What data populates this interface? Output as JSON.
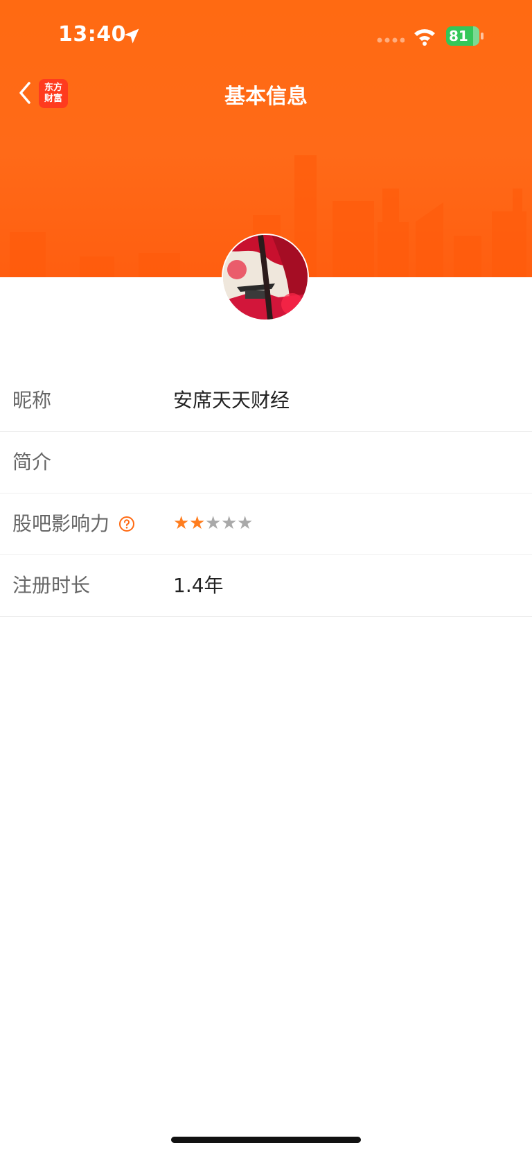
{
  "status_bar": {
    "time": "13:40",
    "battery": "81"
  },
  "nav": {
    "title": "基本信息",
    "logo_line1": "东方",
    "logo_line2": "财富"
  },
  "profile": {
    "rows": [
      {
        "label": "昵称",
        "value": "安席天天财经"
      },
      {
        "label": "简介",
        "value": ""
      },
      {
        "label": "股吧影响力",
        "rating": 2,
        "max": 5
      },
      {
        "label": "注册时长",
        "value": "1.4年"
      }
    ]
  },
  "colors": {
    "brand_orange": "#ff6a12",
    "star_on": "#ff7d1e",
    "star_off": "#a9a9a9"
  }
}
